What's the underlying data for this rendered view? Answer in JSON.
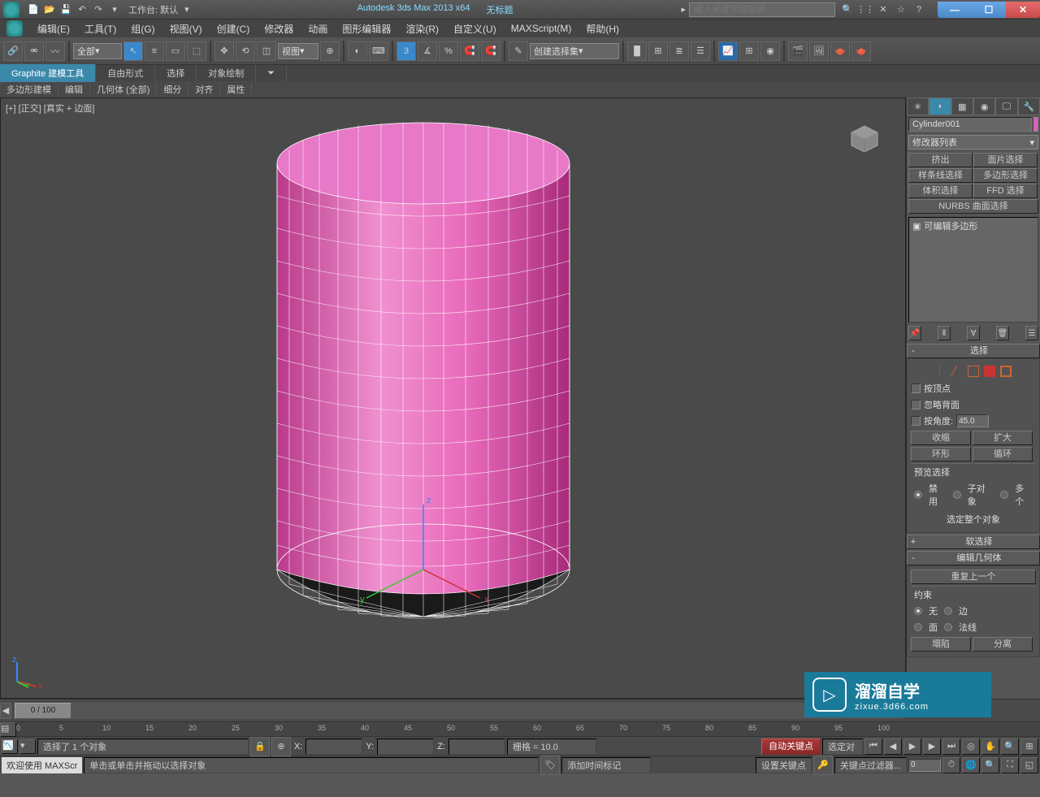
{
  "titlebar": {
    "workspace_label": "工作台: 默认",
    "app_name": "Autodesk 3ds Max  2013 x64",
    "doc_title": "无标题",
    "search_placeholder": "键入关键字或短语"
  },
  "menubar": {
    "items": [
      "编辑(E)",
      "工具(T)",
      "组(G)",
      "视图(V)",
      "创建(C)",
      "修改器",
      "动画",
      "图形编辑器",
      "渲染(R)",
      "自定义(U)",
      "MAXScript(M)",
      "帮助(H)"
    ]
  },
  "toolbar": {
    "filter_dd": "全部",
    "view_dd": "视图",
    "angle_label": "3",
    "named_sel": "创建选择集"
  },
  "ribbon": {
    "tabs": [
      "Graphite 建模工具",
      "自由形式",
      "选择",
      "对象绘制"
    ],
    "sub": [
      "多边形建模",
      "编辑",
      "几何体 (全部)",
      "细分",
      "对齐",
      "属性"
    ]
  },
  "viewport": {
    "label": "[+] [正交] [真实 + 边面]"
  },
  "right_panel": {
    "object_name": "Cylinder001",
    "modifier_list": "修改器列表",
    "mod_buttons": [
      "挤出",
      "面片选择",
      "样条线选择",
      "多边形选择",
      "体积选择",
      "FFD 选择"
    ],
    "nurbs_btn": "NURBS 曲面选择",
    "stack_item": "可编辑多边形",
    "rollouts": {
      "selection": {
        "title": "选择",
        "by_vertex": "按顶点",
        "ignore_backface": "忽略背面",
        "by_angle": "按角度:",
        "angle_val": "45.0",
        "shrink": "收缩",
        "grow": "扩大",
        "ring": "环形",
        "loop": "循环",
        "preview_label": "预览选择",
        "disable": "禁用",
        "subobj": "子对象",
        "multi": "多个",
        "sel_whole": "选定整个对象"
      },
      "soft_sel": {
        "title": "软选择"
      },
      "edit_geom": {
        "title": "编辑几何体",
        "repeat": "重复上一个",
        "constraint": "约束",
        "none": "无",
        "edge": "边",
        "face": "面",
        "normal": "法线",
        "collapse": "塌陷",
        "detach": "分离"
      }
    }
  },
  "timeline": {
    "slider": "0 / 100",
    "ticks": [
      "0",
      "5",
      "10",
      "15",
      "20",
      "25",
      "30",
      "35",
      "40",
      "45",
      "50",
      "55",
      "60",
      "65",
      "70",
      "75",
      "80",
      "85",
      "90",
      "95",
      "100"
    ]
  },
  "status": {
    "selected": "选择了 1 个对象",
    "x_label": "X:",
    "y_label": "Y:",
    "z_label": "Z:",
    "grid": "栅格 = 10.0",
    "auto_key": "自动关键点",
    "sel_set_dd": "选定对",
    "set_key": "设置关键点",
    "key_filter": "关键点过滤器...",
    "welcome": "欢迎使用  MAXScr",
    "hint": "单击或单击并拖动以选择对象",
    "add_time": "添加时间标记"
  },
  "watermark": {
    "cn": "溜溜自学",
    "en": "zixue.3d66.com"
  }
}
